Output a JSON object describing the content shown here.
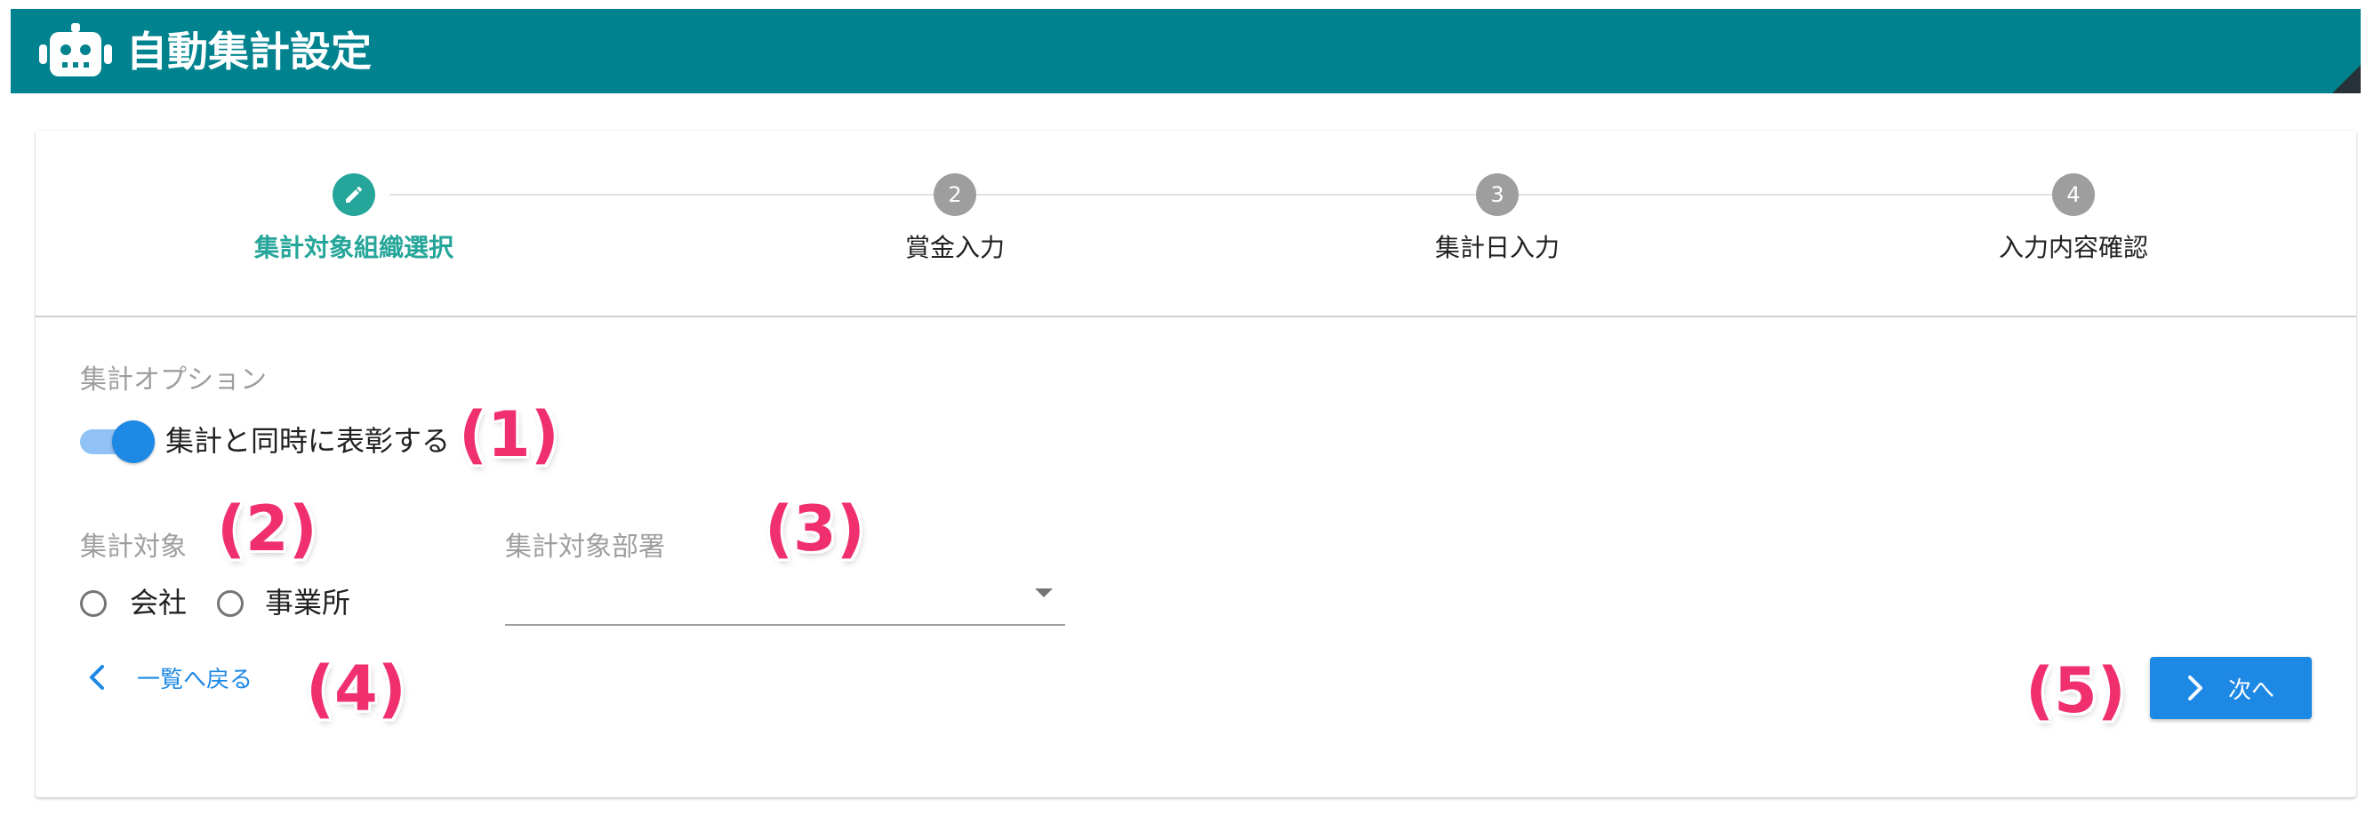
{
  "header": {
    "title": "自動集計設定",
    "icon": "robot-icon",
    "color": "#00838f"
  },
  "stepper": {
    "steps": [
      {
        "number": "1",
        "label": "集計対象組織選択",
        "active": true,
        "icon": "pencil-icon"
      },
      {
        "number": "2",
        "label": "賞金入力",
        "active": false
      },
      {
        "number": "3",
        "label": "集計日入力",
        "active": false
      },
      {
        "number": "4",
        "label": "入力内容確認",
        "active": false
      }
    ],
    "active_color": "#26a69a",
    "inactive_color": "#9e9e9e"
  },
  "options": {
    "section_label": "集計オプション",
    "toggle": {
      "label": "集計と同時に表彰する",
      "on": true
    }
  },
  "target": {
    "section_label": "集計対象",
    "radios": [
      {
        "label": "会社",
        "checked": false
      },
      {
        "label": "事業所",
        "checked": false
      }
    ]
  },
  "department": {
    "section_label": "集計対象部署",
    "value": ""
  },
  "actions": {
    "back_label": "一覧へ戻る",
    "next_label": "次へ",
    "accent": "#1e88e5"
  },
  "callouts": {
    "c1": "(1)",
    "c2": "(2)",
    "c3": "(3)",
    "c4": "(4)",
    "c5": "(5)",
    "color": "#f0306e"
  }
}
